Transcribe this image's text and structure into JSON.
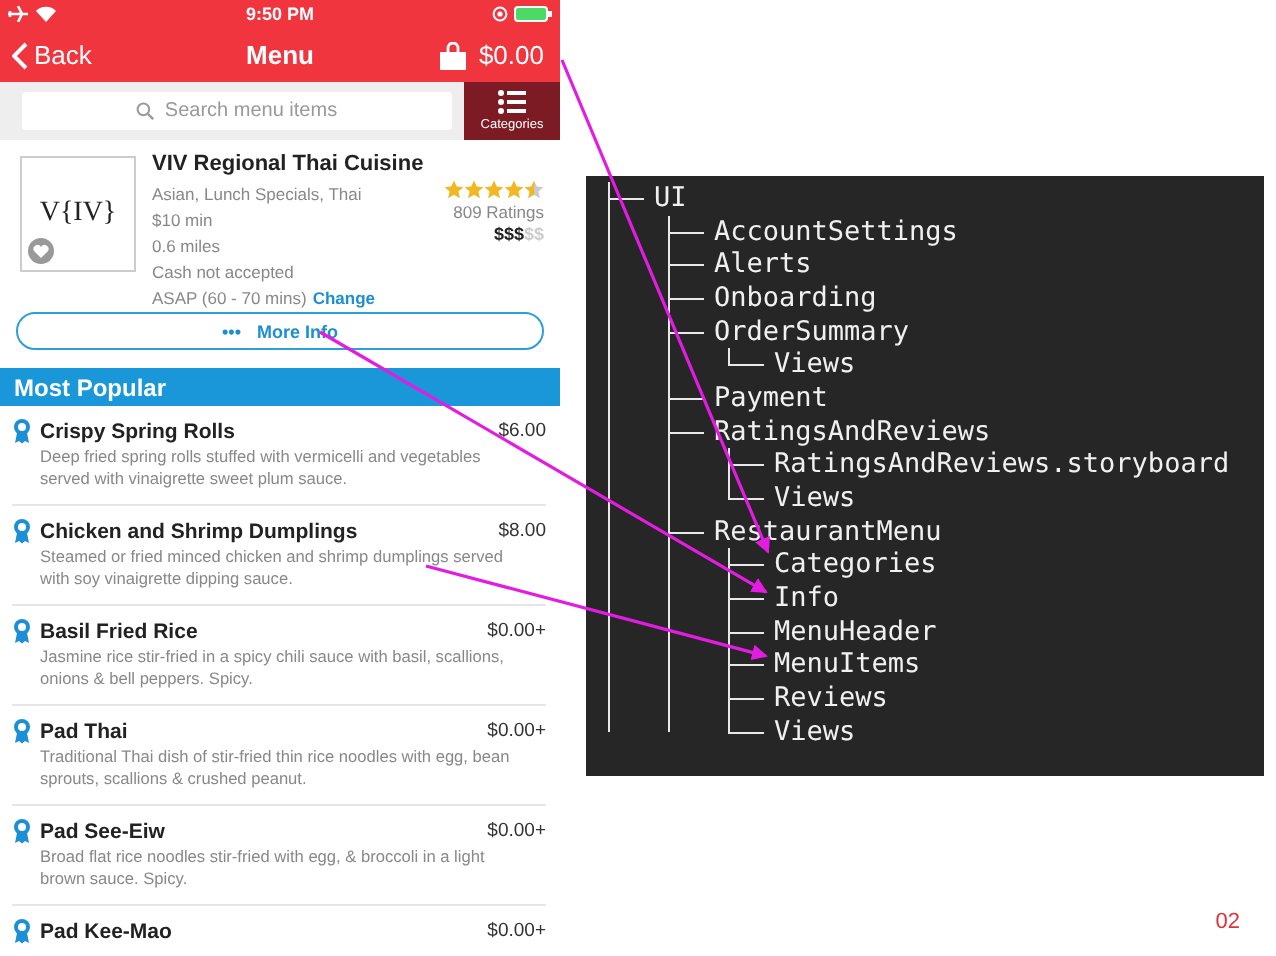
{
  "phone": {
    "status_bar": {
      "time": "9:50 PM"
    },
    "nav": {
      "back": "Back",
      "title": "Menu",
      "cart_total": "$0.00"
    },
    "search": {
      "placeholder": "Search menu items",
      "categories": "Categories"
    },
    "restaurant": {
      "logo": "V{IV}",
      "favorite": false,
      "name": "VIV Regional Thai Cuisine",
      "cuisine": "Asian, Lunch Specials, Thai",
      "minimum": "$10 min",
      "distance": "0.6 miles",
      "payment": "Cash not accepted",
      "delivery_time": "ASAP (60 - 70 mins)",
      "change_link": "Change",
      "stars": 4.5,
      "ratings": "809 Ratings",
      "price_active": "$$$",
      "price_inactive": "$$"
    },
    "more_info": {
      "icon": "•••",
      "label": "More Info"
    },
    "section": "Most Popular",
    "items": [
      {
        "title": "Crispy Spring Rolls",
        "price": "$6.00",
        "description": "Deep fried spring rolls stuffed with vermicelli and vegetables served with vinaigrette sweet plum sauce."
      },
      {
        "title": "Chicken and Shrimp Dumplings",
        "price": "$8.00",
        "description": "Steamed or fried minced chicken and shrimp dumplings served with soy vinaigrette dipping sauce."
      },
      {
        "title": "Basil Fried Rice",
        "price": "$0.00+",
        "description": "Jasmine rice stir-fried in a spicy chili sauce with basil, scallions, onions & bell peppers. Spicy."
      },
      {
        "title": "Pad Thai",
        "price": "$0.00+",
        "description": "Traditional Thai dish of stir-fried thin rice noodles with egg, bean sprouts, scallions & crushed peanut."
      },
      {
        "title": "Pad See-Eiw",
        "price": "$0.00+",
        "description": "Broad flat rice noodles stir-fried with egg, & broccoli in a light brown sauce. Spicy."
      },
      {
        "title": "Pad Kee-Mao",
        "price": "$0.00+"
      }
    ]
  },
  "tree": [
    {
      "name": "UI",
      "children": [
        {
          "name": "AccountSettings"
        },
        {
          "name": "Alerts"
        },
        {
          "name": "Onboarding"
        },
        {
          "name": "OrderSummary",
          "children": [
            {
              "name": "Views"
            }
          ]
        },
        {
          "name": "Payment"
        },
        {
          "name": "RatingsAndReviews",
          "children": [
            {
              "name": "RatingsAndReviews.storyboard"
            },
            {
              "name": "Views"
            }
          ]
        },
        {
          "name": "RestaurantMenu",
          "children": [
            {
              "name": "Categories"
            },
            {
              "name": "Info"
            },
            {
              "name": "MenuHeader"
            },
            {
              "name": "MenuItems"
            },
            {
              "name": "Reviews"
            },
            {
              "name": "Views"
            }
          ]
        }
      ]
    }
  ],
  "page_number": "02"
}
